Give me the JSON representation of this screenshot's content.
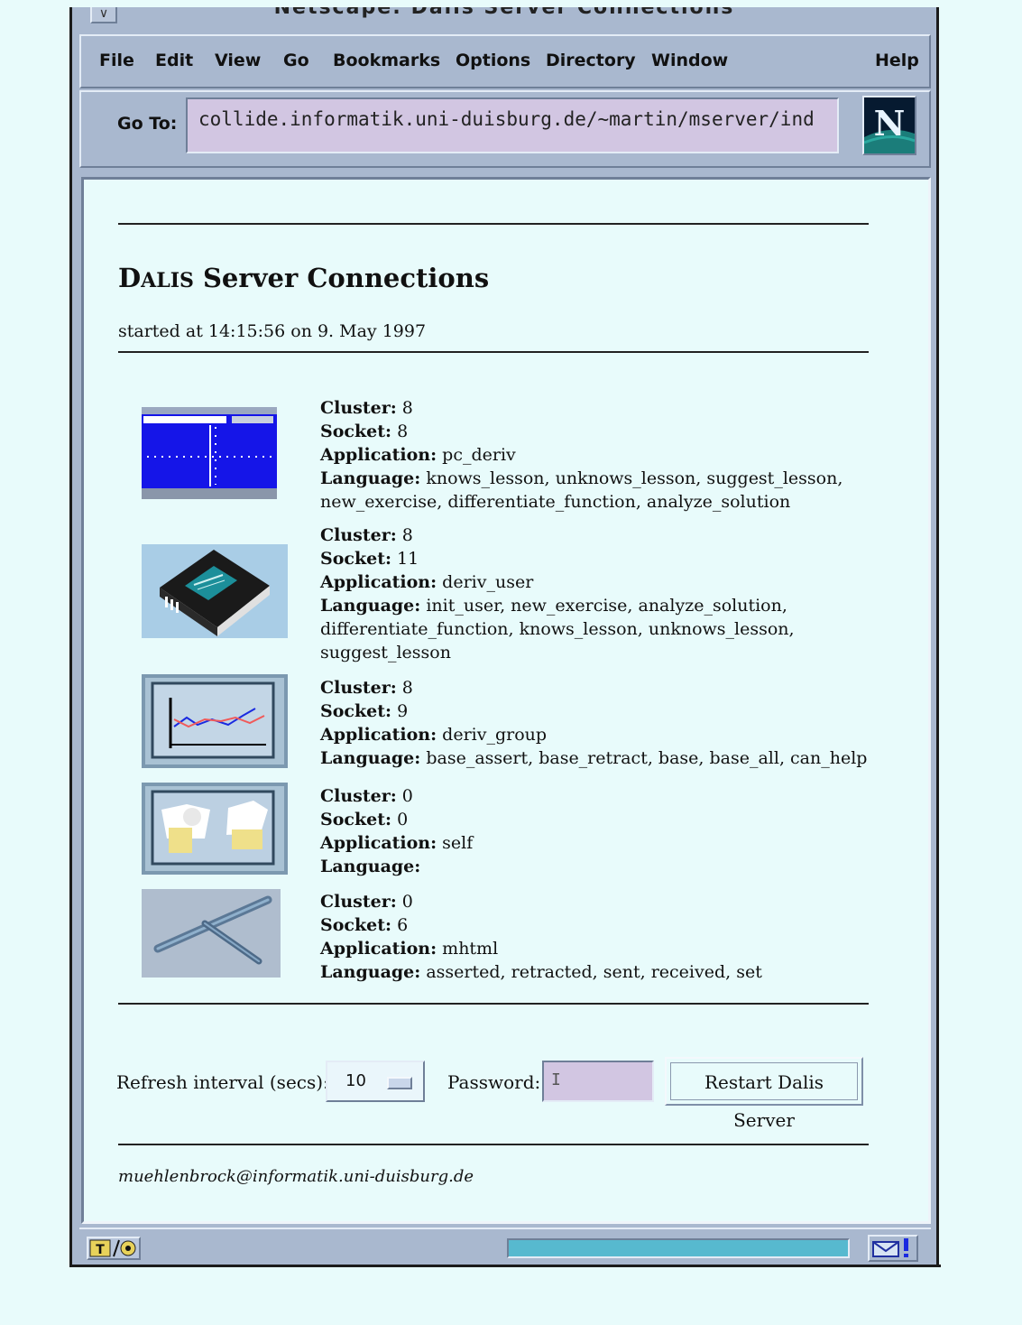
{
  "window": {
    "title": "Netscape: Dalis Server Connections"
  },
  "menubar": {
    "items": [
      "File",
      "Edit",
      "View",
      "Go",
      "Bookmarks",
      "Options",
      "Directory",
      "Window"
    ],
    "help": "Help"
  },
  "toolbar": {
    "goto_label": "Go To:",
    "url": "collide.informatik.uni-duisburg.de/~martin/mserver/ind"
  },
  "page": {
    "title_caps": "D",
    "title_small": "ALIS",
    "title_rest": " Server Connections",
    "started": "started at 14:15:56 on 9. May 1997"
  },
  "labels": {
    "cluster": "Cluster:",
    "socket": "Socket:",
    "application": "Application:",
    "language": "Language:"
  },
  "connections": [
    {
      "cluster": "8",
      "socket": "8",
      "application": "pc_deriv",
      "language": "knows_lesson, unknows_lesson, suggest_lesson, new_exercise, differentiate_function, analyze_solution",
      "icon": "plot-window-icon"
    },
    {
      "cluster": "8",
      "socket": "11",
      "application": "deriv_user",
      "language": "init_user, new_exercise, analyze_solution, differentiate_function, knows_lesson, unknows_lesson, suggest_lesson",
      "icon": "book-icon"
    },
    {
      "cluster": "8",
      "socket": "9",
      "application": "deriv_group",
      "language": "base_assert, base_retract, base, base_all, can_help",
      "icon": "line-chart-icon"
    },
    {
      "cluster": "0",
      "socket": "0",
      "application": "self",
      "language": "",
      "icon": "papers-icon"
    },
    {
      "cluster": "0",
      "socket": "6",
      "application": "mhtml",
      "language": "asserted, retracted, sent, received, set",
      "icon": "pens-icon"
    }
  ],
  "controls": {
    "refresh_label": "Refresh interval (secs):",
    "refresh_value": "10",
    "password_label": "Password:",
    "password_value": "",
    "restart_label": "Restart Dalis Server"
  },
  "footer": {
    "email": "muehlenbrock@informatik.uni-duisburg.de"
  },
  "status": {
    "progress": 1.0
  },
  "colors": {
    "background": "#e8fbfb",
    "chrome": "#a9b8cf",
    "url_field": "#d2c6e2",
    "progress": "#57b9cf"
  }
}
